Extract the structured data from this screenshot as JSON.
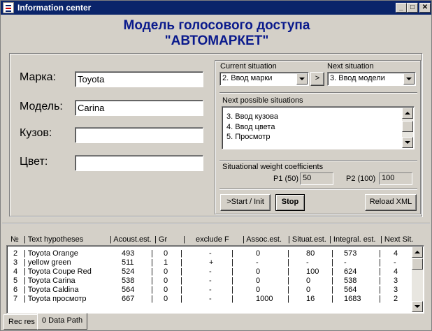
{
  "window": {
    "title": "Information center",
    "controls": {
      "minimize": "_",
      "maximize": "□",
      "close": "✕"
    }
  },
  "heading": {
    "line1": "Модель голосового доступа",
    "line2": "\"АВТОМАРКЕТ\""
  },
  "form": {
    "fields": [
      {
        "label": "Марка:",
        "value": "Toyota"
      },
      {
        "label": "Модель:",
        "value": "Carina"
      },
      {
        "label": "Кузов:",
        "value": ""
      },
      {
        "label": "Цвет:",
        "value": ""
      }
    ]
  },
  "situation": {
    "current_label": "Current situation",
    "current_value": "2. Ввод марки",
    "next_button": ">",
    "next_label": "Next situation",
    "next_value": "3. Ввод модели",
    "possible_label": "Next possible situations",
    "possible": [
      "3. Ввод кузова",
      "4. Ввод цвета",
      "5. Просмотр"
    ],
    "weights_label": "Situational weight coefficients",
    "p1_label": "P1 (50)",
    "p1_value": "50",
    "p2_label": "P2 (100)",
    "p2_value": "100"
  },
  "buttons": {
    "start": ">Start / Init",
    "stop": "Stop",
    "reload": "Reload XML"
  },
  "table": {
    "headers": [
      "№",
      "| Text  hypotheses",
      "| Acoust.est.",
      "| Gr",
      "|",
      "exclude F",
      "| Assoc.est.",
      "| Situat.est.",
      "| Integral. est.",
      "| Next Sit."
    ],
    "rows": [
      [
        "2",
        "| Toyota Orange",
        "493",
        "|",
        "0",
        "|",
        "-",
        "|",
        "0",
        "|",
        "80",
        "|",
        "573",
        "|",
        "4"
      ],
      [
        "3",
        "| yellow green",
        "511",
        "|",
        "1",
        "|",
        "+",
        "|",
        "-",
        "|",
        "-",
        "|",
        "-",
        "|",
        "-"
      ],
      [
        "4",
        "| Toyota Coupe Red",
        "524",
        "|",
        "0",
        "|",
        "-",
        "|",
        "0",
        "|",
        "100",
        "|",
        "624",
        "|",
        "4"
      ],
      [
        "5",
        "| Toyota Carina",
        "538",
        "|",
        "0",
        "|",
        "-",
        "|",
        "0",
        "|",
        "0",
        "|",
        "538",
        "|",
        "3"
      ],
      [
        "6",
        "| Toyota Caldina",
        "564",
        "|",
        "0",
        "|",
        "-",
        "|",
        "0",
        "|",
        "0",
        "|",
        "564",
        "|",
        "3"
      ],
      [
        "7",
        "| Toyota просмотр",
        "667",
        "|",
        "0",
        "|",
        "-",
        "|",
        "1000",
        "|",
        "16",
        "|",
        "1683",
        "|",
        "2"
      ]
    ]
  },
  "tabs": [
    "Rec res",
    "0 Data Path"
  ]
}
